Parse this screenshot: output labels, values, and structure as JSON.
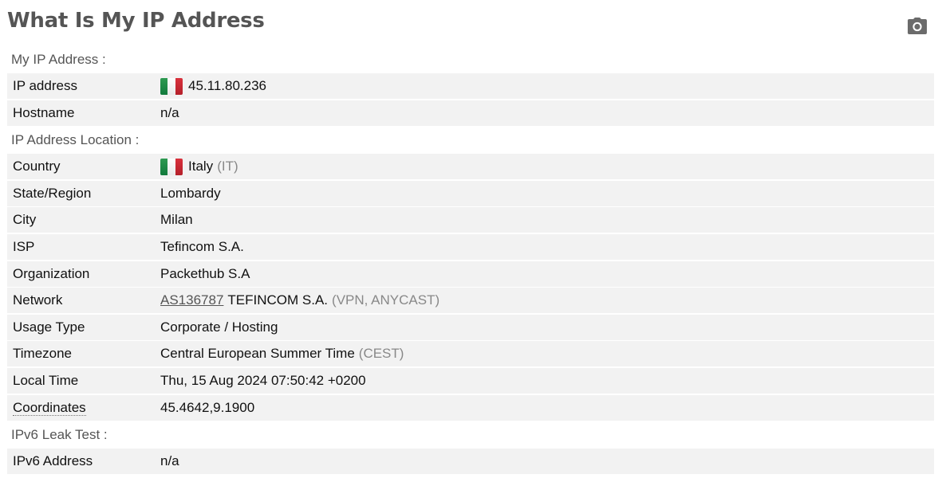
{
  "page": {
    "title": "What Is My IP Address"
  },
  "icons": {
    "screenshot": "camera-icon",
    "flag": "italy-flag-icon"
  },
  "colors": {
    "row_bg": "#f2f2f2",
    "label": "#555555",
    "muted": "#888888"
  },
  "sections": {
    "ip": {
      "label": "My IP Address :",
      "ip_address": {
        "key": "IP address",
        "value": "45.11.80.236"
      },
      "hostname": {
        "key": "Hostname",
        "value": "n/a"
      }
    },
    "location": {
      "label": "IP Address Location :",
      "country": {
        "key": "Country",
        "value": "Italy",
        "code": "(IT)"
      },
      "state": {
        "key": "State/Region",
        "value": "Lombardy"
      },
      "city": {
        "key": "City",
        "value": "Milan"
      },
      "isp": {
        "key": "ISP",
        "value": "Tefincom S.A."
      },
      "organization": {
        "key": "Organization",
        "value": "Packethub S.A"
      },
      "network": {
        "key": "Network",
        "asn": "AS136787",
        "name": "TEFINCOM S.A.",
        "tags": "(VPN, ANYCAST)"
      },
      "usage_type": {
        "key": "Usage Type",
        "value": "Corporate / Hosting"
      },
      "timezone": {
        "key": "Timezone",
        "value": "Central European Summer Time",
        "abbr": "(CEST)"
      },
      "local_time": {
        "key": "Local Time",
        "value": "Thu, 15 Aug 2024 07:50:42 +0200"
      },
      "coordinates": {
        "key": "Coordinates",
        "value": "45.4642,9.1900"
      }
    },
    "ipv6": {
      "label": "IPv6 Leak Test :",
      "ipv6_address": {
        "key": "IPv6 Address",
        "value": "n/a"
      }
    }
  }
}
